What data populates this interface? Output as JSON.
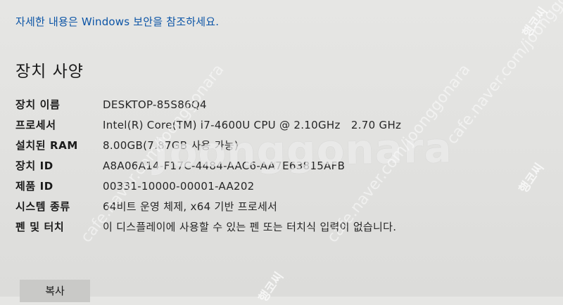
{
  "header": {
    "security_link": "자세한 내용은 Windows 보안을 참조하세요."
  },
  "device_specs": {
    "title": "장치 사양",
    "rows": [
      {
        "label": "장치 이름",
        "value": "DESKTOP-85S86Q4"
      },
      {
        "label": "프로세서",
        "value": "Intel(R) Core(TM) i7-4600U CPU @ 2.10GHz   2.70 GHz"
      },
      {
        "label": "설치된 RAM",
        "value": "8.00GB(7.87GB 사용 가능)"
      },
      {
        "label": "장치 ID",
        "value": "A8A06A14-F17C-4484-AAC6-AA7E63815AFB"
      },
      {
        "label": "제품 ID",
        "value": "00331-10000-00001-AA202"
      },
      {
        "label": "시스템 종류",
        "value": "64비트 운영 체제, x64 기반 프로세서"
      },
      {
        "label": "펜 및 터치",
        "value": "이 디스플레이에 사용할 수 있는 펜 또는 터치식 입력이 없습니다."
      }
    ],
    "copy_button": "복사"
  },
  "watermark": {
    "main": "Joonggonara",
    "diag": "cafe.naver.com/joonggonara",
    "vert": "행코씨"
  }
}
